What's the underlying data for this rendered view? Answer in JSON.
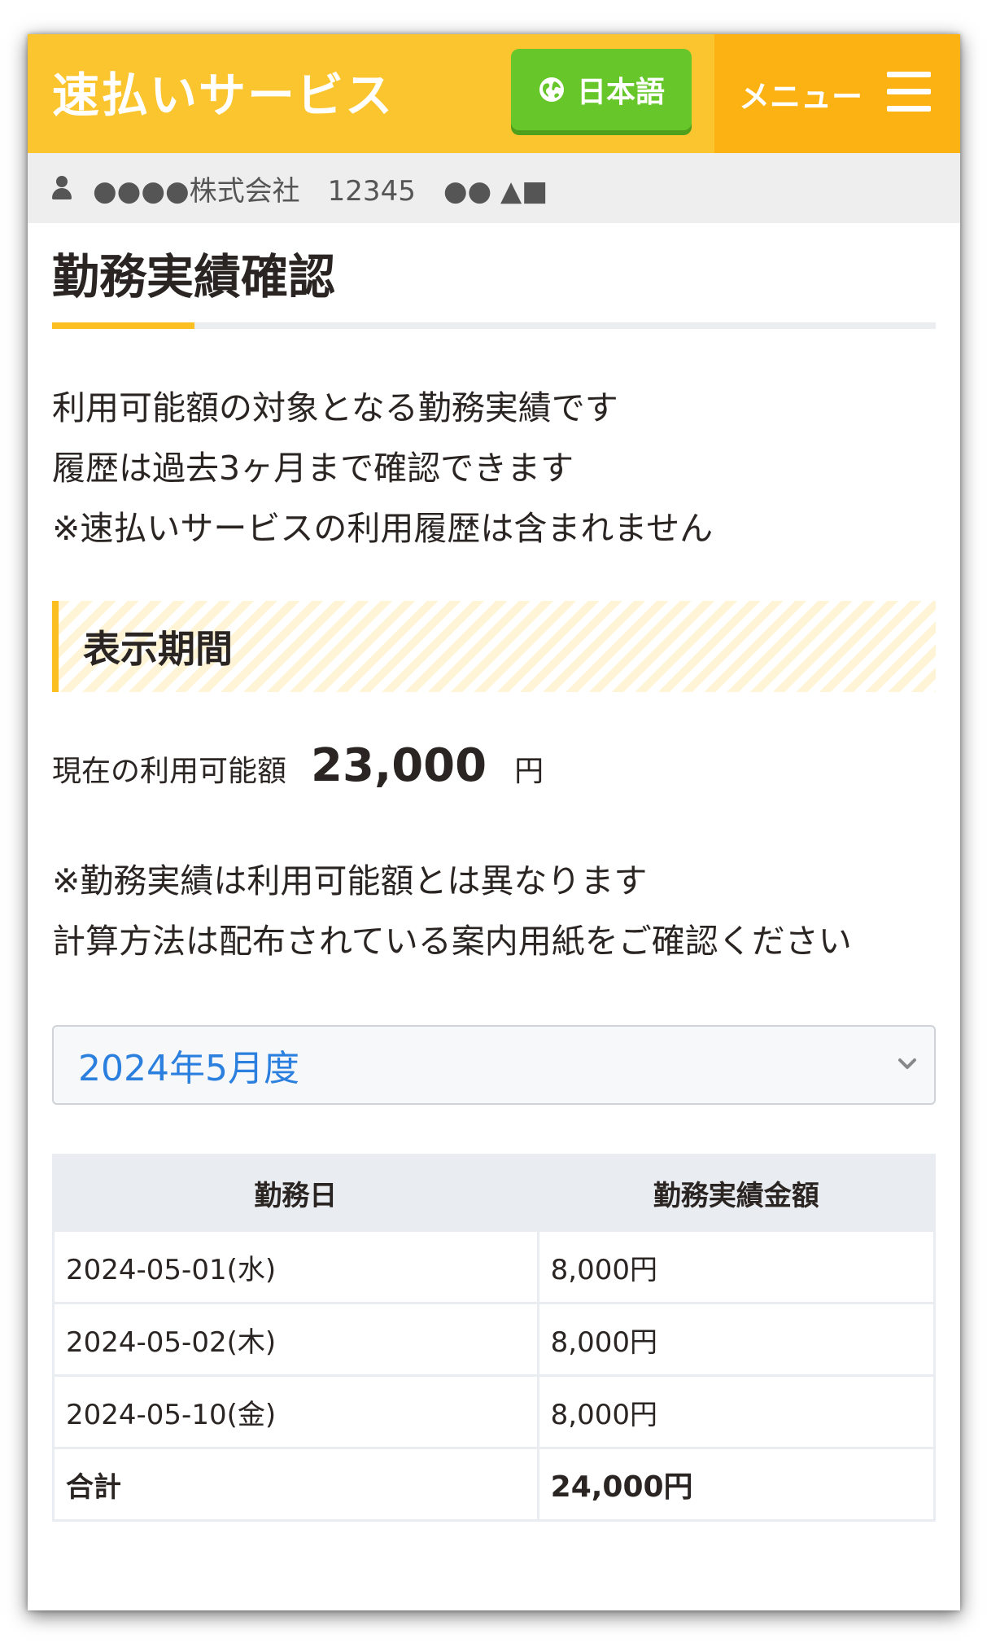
{
  "header": {
    "brand": "速払いサービス",
    "language_button": "日本語",
    "menu_label": "メニュー",
    "colors": {
      "header": "#fbc52f",
      "menu": "#fcb212",
      "language": "#67c72a"
    }
  },
  "user_bar": {
    "icon": "user-icon",
    "text": "●●●●株式会社　12345　●● ▲■"
  },
  "page": {
    "title": "勤務実績確認",
    "intro_lines": [
      "利用可能額の対象となる勤務実績です",
      "履歴は過去3ヶ月まで確認できます",
      "※速払いサービスの利用履歴は含まれません"
    ]
  },
  "section": {
    "title": "表示期間"
  },
  "available": {
    "label": "現在の利用可能額",
    "amount": "23,000",
    "unit": "円"
  },
  "note_lines": [
    "※勤務実績は利用可能額とは異なります",
    "計算方法は配布されている案内用紙をご確認ください"
  ],
  "period_select": {
    "value": "2024年5月度"
  },
  "table": {
    "headers": [
      "勤務日",
      "勤務実績金額"
    ],
    "rows": [
      {
        "date": "2024-05-01(水)",
        "amount": "8,000円"
      },
      {
        "date": "2024-05-02(木)",
        "amount": "8,000円"
      },
      {
        "date": "2024-05-10(金)",
        "amount": "8,000円"
      }
    ],
    "total": {
      "label": "合計",
      "amount": "24,000円"
    }
  }
}
